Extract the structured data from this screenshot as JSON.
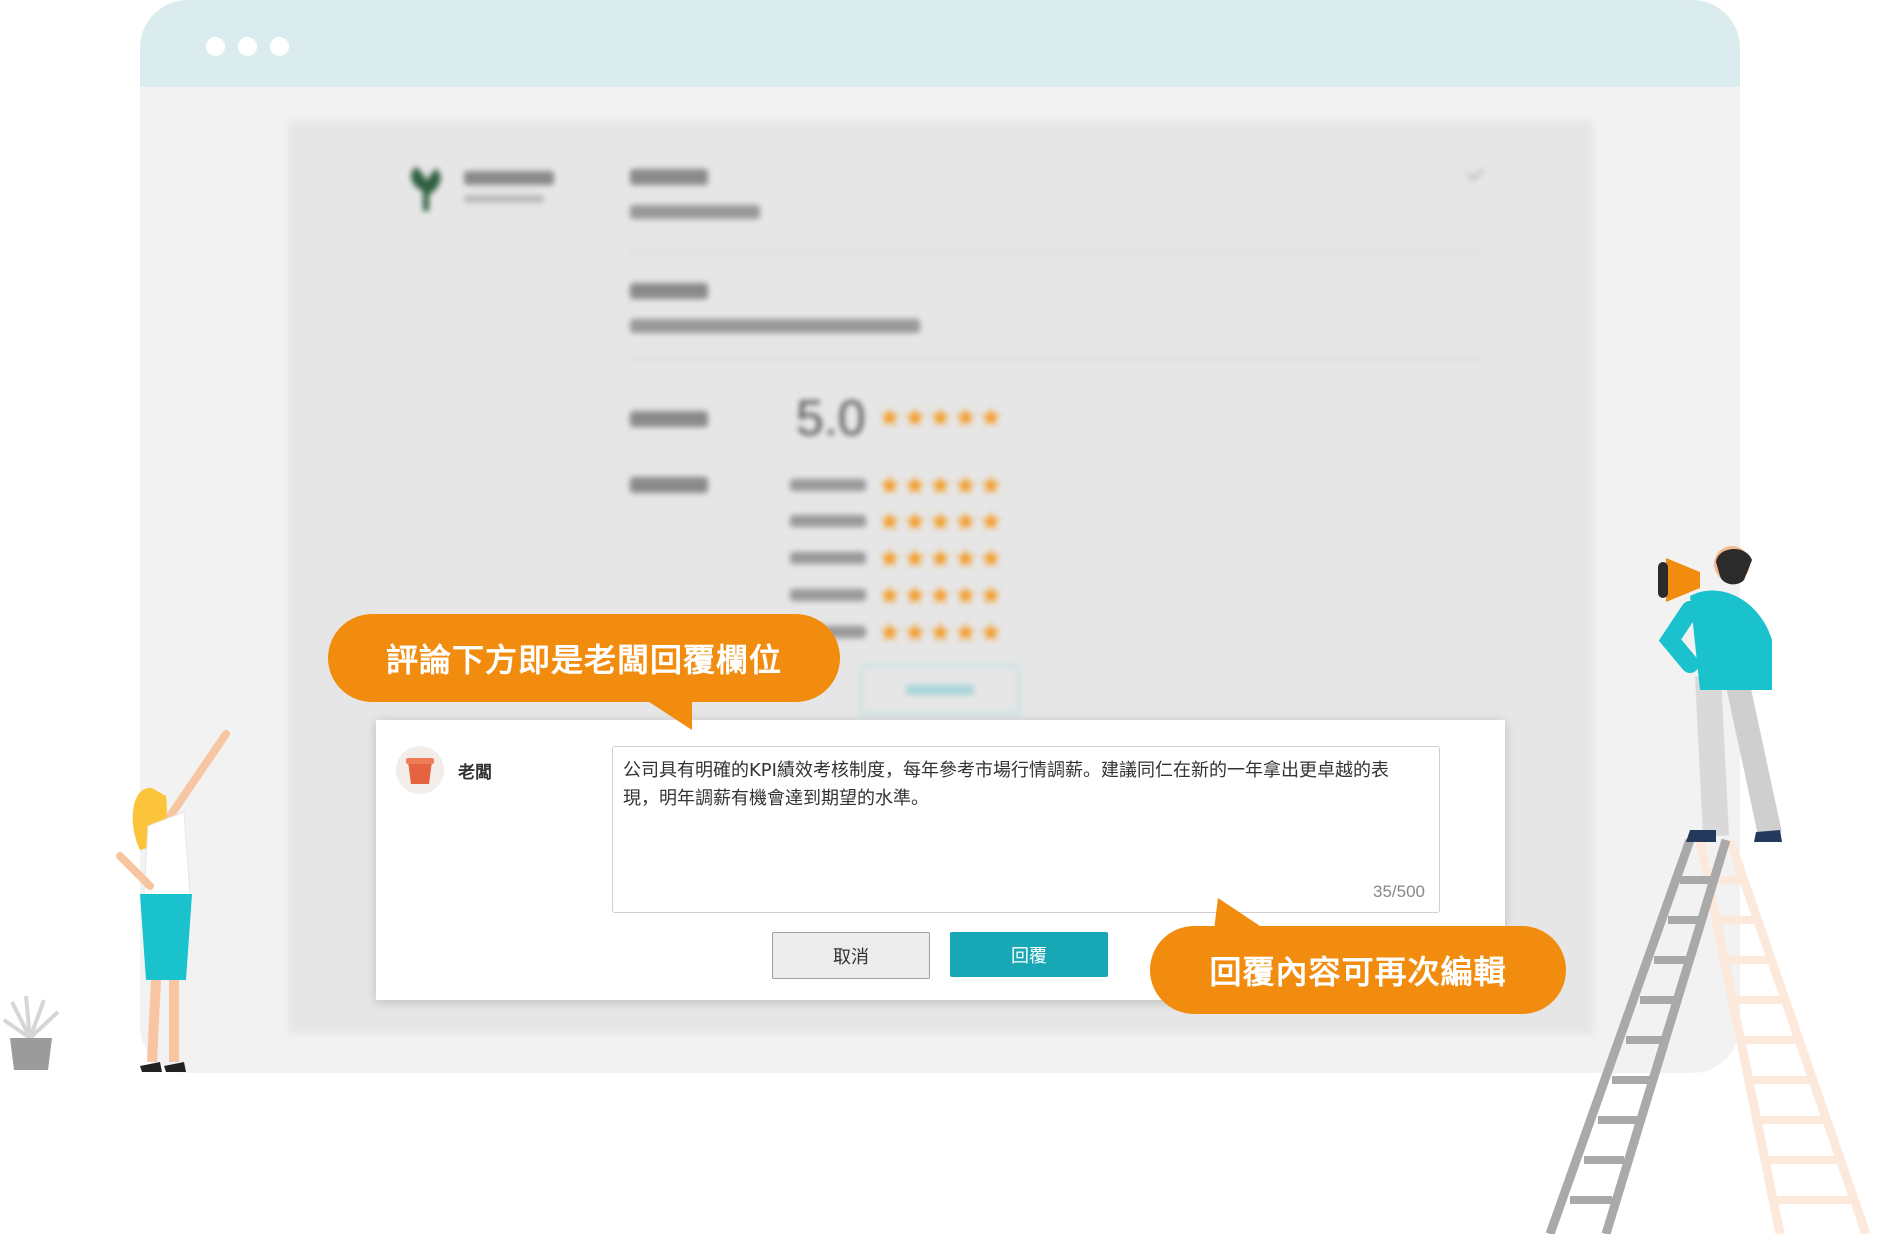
{
  "reply": {
    "author": "老闆",
    "text": "公司具有明確的KPI績效考核制度，每年參考市場行情調薪。建議同仁在新的一年拿出更卓越的表現，明年調薪有機會達到期望的水準。",
    "char_count": "35/500",
    "cancel_label": "取消",
    "submit_label": "回覆"
  },
  "review": {
    "overall_score": "5.0",
    "overall_stars": 5,
    "rows_stars": [
      5,
      5,
      5,
      5,
      5
    ]
  },
  "callouts": {
    "reply_area": "評論下方即是老闆回覆欄位",
    "editable": "回覆內容可再次編輯"
  },
  "colors": {
    "accent": "#18a7b5",
    "callout": "#f28c0f",
    "star": "#f49a22",
    "titlebar": "#dbecee"
  }
}
